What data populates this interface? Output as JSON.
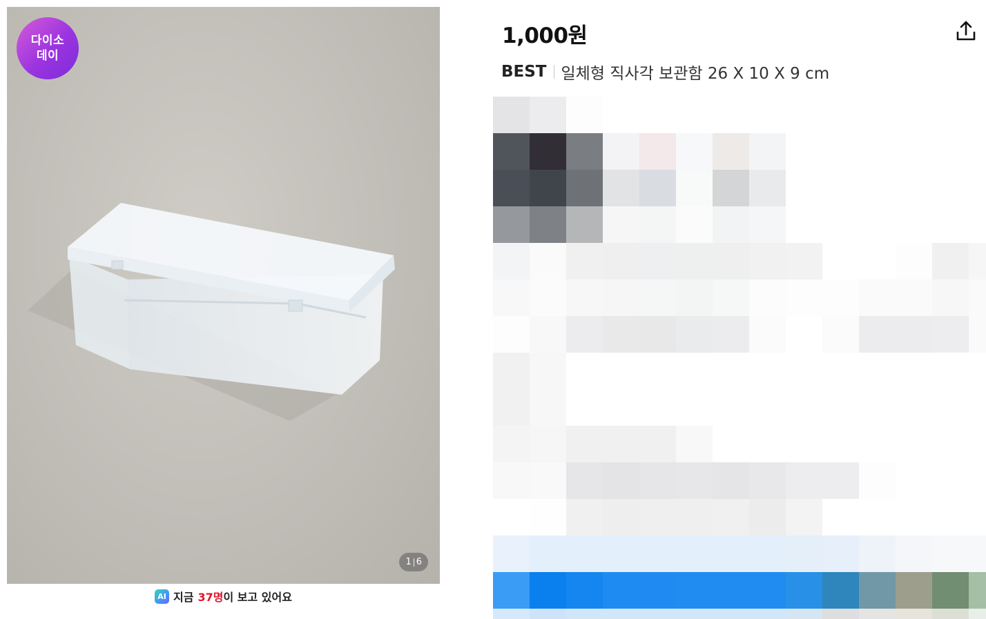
{
  "gallery": {
    "badge_line1": "다이소",
    "badge_line2": "데이",
    "counter_current": "1",
    "counter_total": "6"
  },
  "viewers": {
    "ai_label": "AI",
    "prefix": "지금",
    "count": "37명",
    "suffix": "이 보고 있어요"
  },
  "product": {
    "price": "1,000원",
    "best_label": "BEST",
    "name": "일체형 직사각 보관함 26 X 10 X 9 cm"
  },
  "icons": {
    "share": "share-icon"
  },
  "colors": {
    "badge_purple": "#9a34e0",
    "viewer_count_red": "#e0162b",
    "accent_blue": "#1e88f0"
  }
}
